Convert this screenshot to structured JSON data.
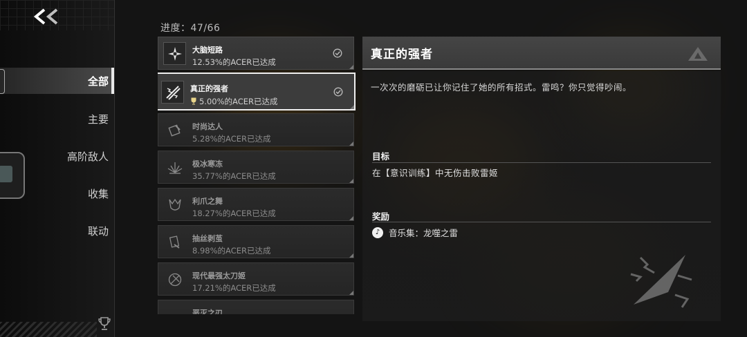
{
  "nav": {
    "back_label": "<<",
    "items": [
      "全部",
      "主要",
      "高阶敌人",
      "收集",
      "联动"
    ],
    "active_index": 0
  },
  "progress": {
    "label": "进度：47/66",
    "current": 47,
    "total": 66
  },
  "achievements": [
    {
      "title": "大脑短路",
      "rate": "12.53%的ACER已达成",
      "unlocked": true,
      "icon": "crossed-blades-icon"
    },
    {
      "title": "真正的强者",
      "rate": "5.00%的ACER已达成",
      "unlocked": true,
      "selected": true,
      "rare": true,
      "icon": "lightning-blades-icon"
    },
    {
      "title": "时尚达人",
      "rate": "5.28%的ACER已达成",
      "unlocked": false,
      "icon": "costume-icon"
    },
    {
      "title": "极冰寒冻",
      "rate": "35.77%的ACER已达成",
      "unlocked": false,
      "icon": "ice-crystal-icon"
    },
    {
      "title": "利爪之舞",
      "rate": "18.27%的ACER已达成",
      "unlocked": false,
      "icon": "claw-icon"
    },
    {
      "title": "抽丝剥茧",
      "rate": "8.98%的ACER已达成",
      "unlocked": false,
      "icon": "cards-icon"
    },
    {
      "title": "现代最强太刀姬",
      "rate": "17.21%的ACER已达成",
      "unlocked": false,
      "icon": "katana-icon"
    },
    {
      "title": "恶灭之刃",
      "rate": "",
      "unlocked": false,
      "icon": "blade-icon"
    }
  ],
  "detail": {
    "title": "真正的强者",
    "description": "一次次的磨砺已让你记住了她的所有招式。雷鸣？你只觉得吵闹。",
    "goal_label": "目标",
    "goal_text": "在【意识训练】中无伤击败雷姬",
    "reward_label": "奖励",
    "reward_text": "音乐集：龙噬之雷"
  }
}
